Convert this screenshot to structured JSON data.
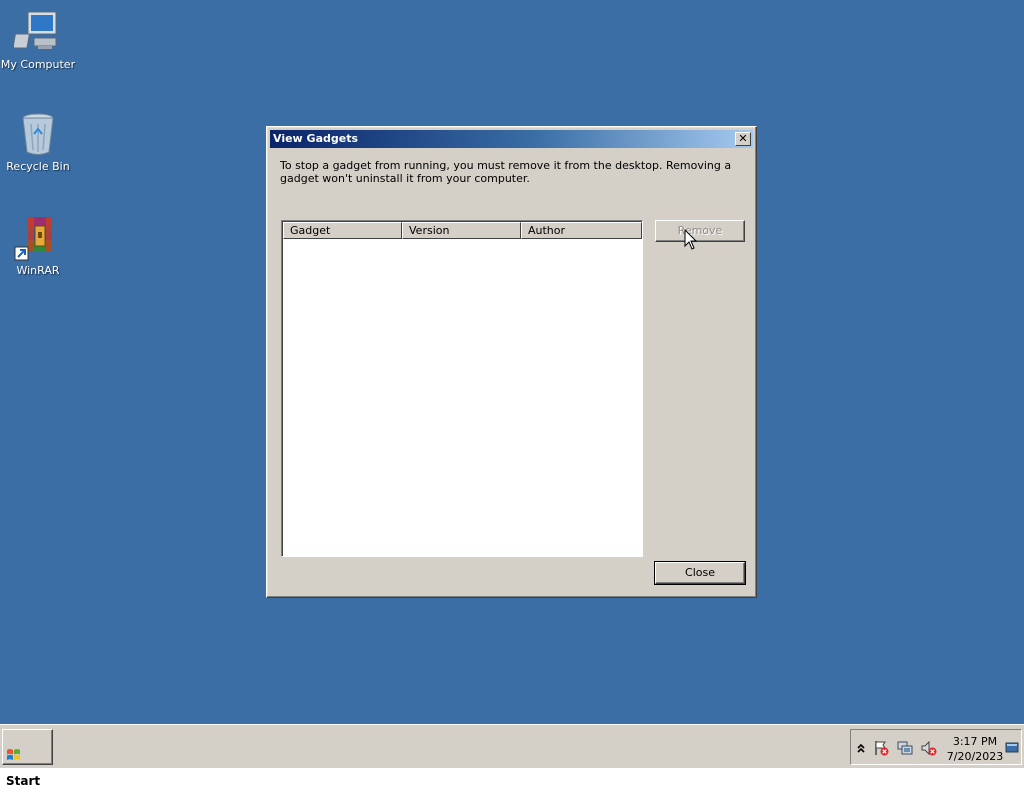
{
  "desktop": {
    "icons": [
      {
        "label": "My Computer",
        "icon": "computer-icon"
      },
      {
        "label": "Recycle Bin",
        "icon": "recycle-bin-icon"
      },
      {
        "label": "WinRAR",
        "icon": "winrar-icon"
      }
    ],
    "background_color": "#3b6ea5"
  },
  "dialog": {
    "title": "View Gadgets",
    "close_glyph": "✕",
    "description": "To stop a gadget from running, you must remove it from the desktop. Removing a gadget won't uninstall it from your computer.",
    "columns": [
      "Gadget",
      "Version",
      "Author"
    ],
    "rows": [],
    "remove_label": "Remove",
    "close_label": "Close"
  },
  "taskbar": {
    "start_label": "Start",
    "tray_icons": [
      "show-hidden-icon",
      "action-center-flag-icon",
      "network-icon",
      "volume-muted-icon"
    ],
    "time": "3:17 PM",
    "date": "7/20/2023"
  }
}
